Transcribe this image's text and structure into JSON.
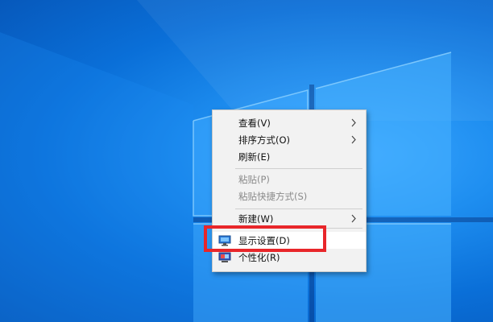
{
  "desktop": {
    "wallpaper": "windows-10-default",
    "accent_color": "#0a6fd8",
    "highlight_color": "#e8262a"
  },
  "context_menu": {
    "items": [
      {
        "label": "查看(V)",
        "submenu": true,
        "enabled": true
      },
      {
        "label": "排序方式(O)",
        "submenu": true,
        "enabled": true
      },
      {
        "label": "刷新(E)",
        "submenu": false,
        "enabled": true
      },
      {
        "label": "粘贴(P)",
        "submenu": false,
        "enabled": false
      },
      {
        "label": "粘贴快捷方式(S)",
        "submenu": false,
        "enabled": false
      },
      {
        "label": "新建(W)",
        "submenu": true,
        "enabled": true
      },
      {
        "label": "显示设置(D)",
        "submenu": false,
        "enabled": true,
        "icon": "display-settings-icon",
        "hovered": true
      },
      {
        "label": "个性化(R)",
        "submenu": false,
        "enabled": true,
        "icon": "personalize-icon"
      }
    ]
  }
}
